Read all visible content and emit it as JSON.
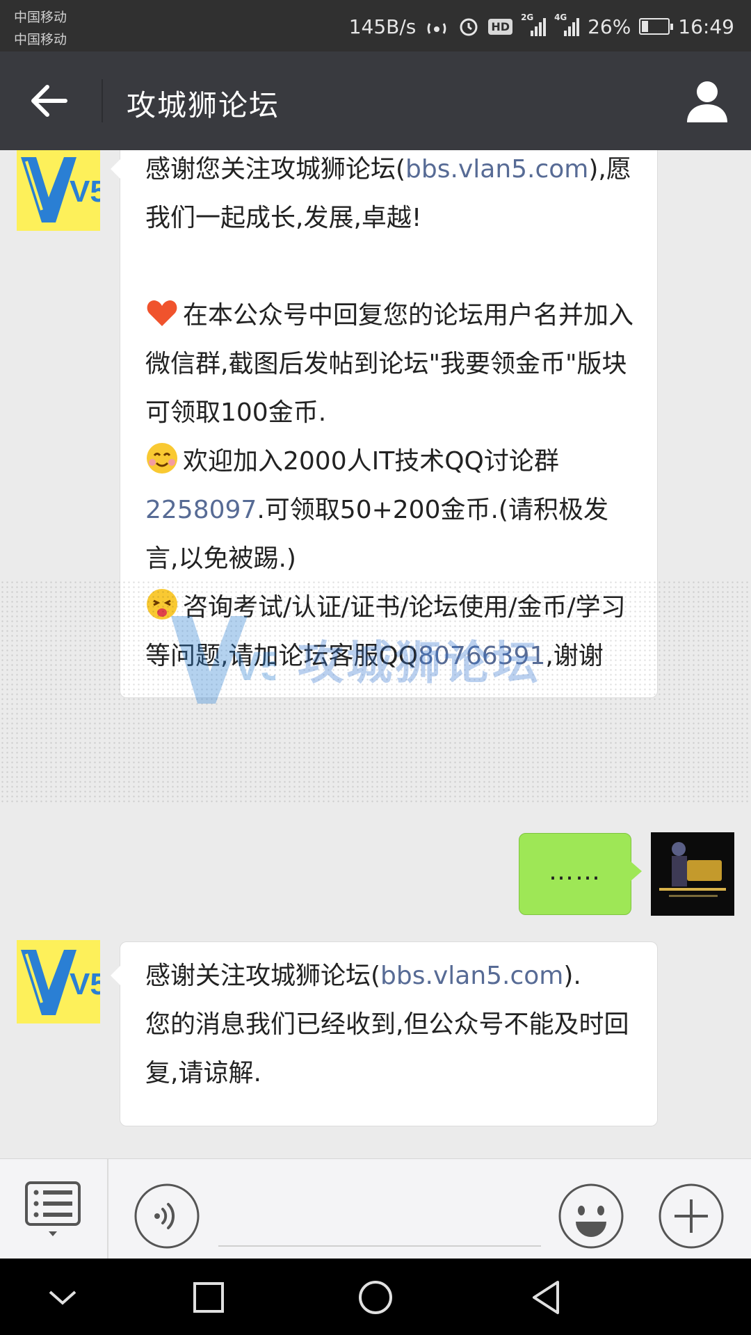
{
  "status_bar": {
    "carrier_1": "中国移动",
    "carrier_2": "中国移动",
    "net_speed": "145B/s",
    "hd_badge": "HD",
    "sig1_label": "2G",
    "sig2_label": "4G",
    "battery_text": "26%",
    "battery_level": 0.26,
    "time": "16:49"
  },
  "titlebar": {
    "title": "攻城狮论坛"
  },
  "messages": [
    {
      "from": "official",
      "line1_a": "感谢您关注攻城狮论坛(",
      "line1_link": "bbs.vlan5.com",
      "line1_b": "),愿我们一起成长,发展,卓越!",
      "para2": "在本公众号中回复您的论坛用户名并加入微信群,截图后发帖到论坛\"我要领金币\"版块可领取100金币.",
      "para3_a": "欢迎加入2000人IT技术QQ讨论群",
      "para3_link": "2258097",
      "para3_b": ".可领取50+200金币.(请积极发言,以免被踢.)",
      "para4_a": "咨询考试/认证/证书/论坛使用/金币/学习等问题,请加论坛客服QQ",
      "para4_link": "80766391",
      "para4_b": ",谢谢"
    },
    {
      "from": "me",
      "text": "……"
    },
    {
      "from": "official",
      "line1_a": "感谢关注攻城狮论坛(",
      "line1_link": "bbs.vlan5.com",
      "line1_b": ").",
      "line2": "您的消息我们已经收到,但公众号不能及时回复,请谅解."
    }
  ],
  "watermark": {
    "text": "攻城狮论坛",
    "logo": "V5"
  },
  "avatar": {
    "logo_text": "V5"
  },
  "colors": {
    "titlebar": "#393a3f",
    "statusbar": "#303030",
    "chat_bg": "#ebebeb",
    "bubble_in": "#ffffff",
    "bubble_out": "#9ee756",
    "link": "#576b95",
    "v5_yellow": "#fdf05a",
    "v5_blue": "#2a7fd4"
  },
  "icons": {
    "back": "arrow-left-icon",
    "profile": "person-icon",
    "menu": "list-menu-icon",
    "voice": "voice-icon",
    "emoji": "smiley-icon",
    "plus": "plus-icon",
    "nav_down": "chevron-down-icon",
    "nav_recent": "square-icon",
    "nav_home": "circle-icon",
    "nav_back": "triangle-back-icon"
  }
}
